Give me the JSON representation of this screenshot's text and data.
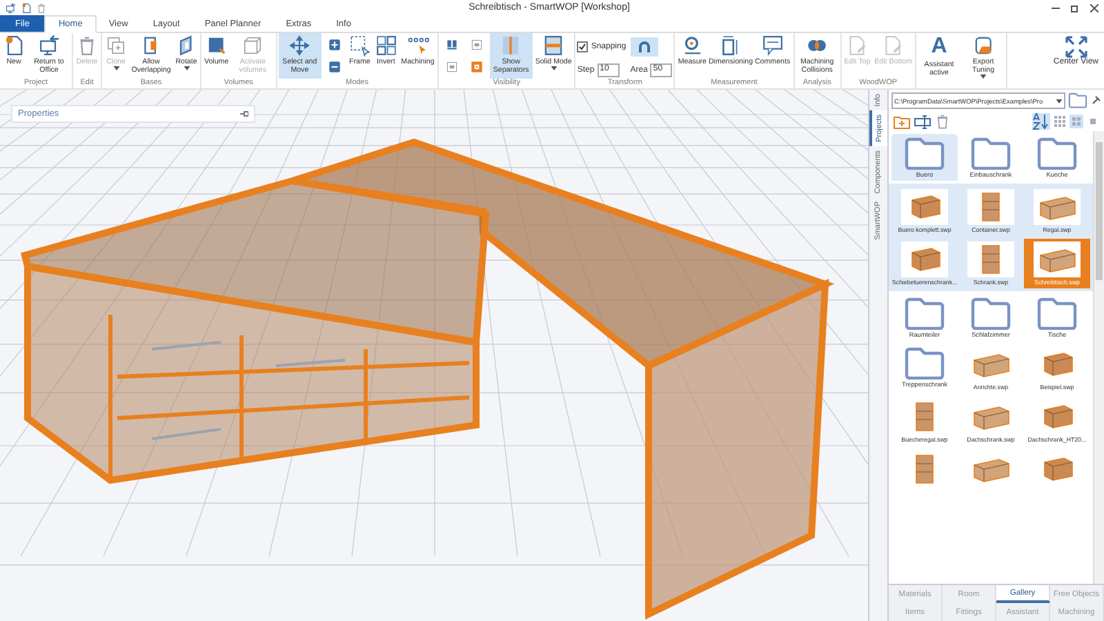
{
  "window": {
    "title": "Schreibtisch - SmartWOP [Workshop]"
  },
  "menu_tabs": [
    {
      "label": "File",
      "kind": "file",
      "selected": false
    },
    {
      "label": "Home",
      "kind": "tab",
      "selected": true
    },
    {
      "label": "View",
      "kind": "tab",
      "selected": false
    },
    {
      "label": "Layout",
      "kind": "tab",
      "selected": false
    },
    {
      "label": "Panel Planner",
      "kind": "tab",
      "selected": false
    },
    {
      "label": "Extras",
      "kind": "tab",
      "selected": false
    },
    {
      "label": "Info",
      "kind": "tab",
      "selected": false
    }
  ],
  "ribbon_groups": [
    {
      "kind": "buttons",
      "label": "Project",
      "buttons": [
        {
          "kind": "new",
          "label": "New",
          "disabled": false,
          "selected": false,
          "dropdown": false
        },
        {
          "kind": "return",
          "label": "Return to Office",
          "disabled": false,
          "selected": false,
          "dropdown": false
        }
      ]
    },
    {
      "kind": "buttons",
      "label": "Edit",
      "buttons": [
        {
          "kind": "delete",
          "label": "Delete",
          "disabled": true,
          "selected": false,
          "dropdown": false
        }
      ]
    },
    {
      "kind": "buttons",
      "label": "Bases",
      "buttons": [
        {
          "kind": "clone",
          "label": "Clone",
          "disabled": true,
          "selected": false,
          "dropdown": true
        },
        {
          "kind": "overlap",
          "label": "Allow Overlapping",
          "disabled": false,
          "selected": false,
          "dropdown": false
        },
        {
          "kind": "rotate",
          "label": "Rotate",
          "disabled": false,
          "selected": false,
          "dropdown": true
        }
      ]
    },
    {
      "kind": "buttons",
      "label": "Volumes",
      "buttons": [
        {
          "kind": "volume",
          "label": "Volume",
          "disabled": false,
          "selected": false,
          "dropdown": false
        },
        {
          "kind": "activate",
          "label": "Activate volumes",
          "disabled": true,
          "selected": false,
          "dropdown": false
        }
      ]
    },
    {
      "kind": "buttons",
      "label": "Modes",
      "buttons": [
        {
          "kind": "select",
          "label": "Select and Move",
          "disabled": false,
          "selected": true,
          "dropdown": false
        },
        {
          "kind": "stack",
          "items": [
            {
              "kind": "plus",
              "selected": false
            },
            {
              "kind": "minus",
              "selected": false
            }
          ]
        },
        {
          "kind": "frame",
          "label": "Frame",
          "disabled": false,
          "selected": false,
          "dropdown": false
        },
        {
          "kind": "invert",
          "label": "Invert",
          "disabled": false,
          "selected": false,
          "dropdown": false
        },
        {
          "kind": "machining",
          "label": "Machining",
          "disabled": false,
          "selected": false,
          "dropdown": false
        }
      ]
    },
    {
      "kind": "buttons",
      "label": "Visibility",
      "buttons": [
        {
          "kind": "stack",
          "items": [
            {
              "kind": "layout",
              "selected": false
            },
            {
              "kind": "grey",
              "selected": false
            }
          ]
        },
        {
          "kind": "stack",
          "items": [
            {
              "kind": "grey",
              "selected": false
            },
            {
              "kind": "orange",
              "selected": false
            }
          ]
        },
        {
          "kind": "separators",
          "label": "Show Separators",
          "disabled": false,
          "selected": true,
          "dropdown": false
        },
        {
          "kind": "solid",
          "label": "Solid Mode",
          "disabled": false,
          "selected": false,
          "dropdown": true
        }
      ]
    },
    {
      "kind": "transform",
      "label": "Transform",
      "snapping": {
        "label": "Snapping",
        "checked": true
      },
      "step": {
        "label": "Step",
        "value": "10"
      },
      "magnet": {
        "selected": true
      },
      "area": {
        "label": "Area",
        "value": "50"
      }
    },
    {
      "kind": "buttons",
      "label": "Measurement",
      "buttons": [
        {
          "kind": "measure",
          "label": "Measure",
          "disabled": false,
          "selected": false,
          "dropdown": false
        },
        {
          "kind": "dimension",
          "label": "Dimensioning",
          "disabled": false,
          "selected": false,
          "dropdown": false
        },
        {
          "kind": "comments",
          "label": "Comments",
          "disabled": false,
          "selected": false,
          "dropdown": false
        }
      ]
    },
    {
      "kind": "buttons",
      "label": "Analysis",
      "buttons": [
        {
          "kind": "collisions",
          "label": "Machining Collisions",
          "disabled": false,
          "selected": false,
          "dropdown": false
        }
      ]
    },
    {
      "kind": "buttons",
      "label": "WoodWOP",
      "buttons": [
        {
          "kind": "edit",
          "label": "Edit Top",
          "disabled": true,
          "selected": false,
          "dropdown": false
        },
        {
          "kind": "edit",
          "label": "Edit Bottom",
          "disabled": true,
          "selected": false,
          "dropdown": false
        }
      ]
    },
    {
      "kind": "buttons",
      "buttons": [
        {
          "kind": "assistant",
          "icon_text": "A",
          "label": "Assistant active",
          "disabled": false,
          "selected": false,
          "dropdown": false
        },
        {
          "kind": "export",
          "label": "Export Tuning",
          "disabled": false,
          "selected": false,
          "dropdown": true
        }
      ]
    }
  ],
  "center_view": {
    "label": "Center View"
  },
  "properties_panel": {
    "title": "Properties"
  },
  "side_tabs": [
    {
      "label": "Info",
      "selected": false
    },
    {
      "label": "Projects",
      "selected": true
    },
    {
      "label": "Components",
      "selected": false
    },
    {
      "label": "SmartWOP",
      "selected": false
    }
  ],
  "path_field": {
    "value": "C:\\ProgramData\\SmartWOP\\Projects\\Examples\\Pro"
  },
  "gallery": {
    "folders": [
      {
        "label": "Buero",
        "selected": true
      },
      {
        "label": "Einbauschrank",
        "selected": false
      },
      {
        "label": "Kueche",
        "selected": false
      }
    ],
    "open_folder_items": [
      {
        "label": "Buero komplett.swp",
        "selected": false
      },
      {
        "label": "Container.swp",
        "selected": false
      },
      {
        "label": "Regal.swp",
        "selected": false
      },
      {
        "label": "Schiebetuerenschrank...",
        "selected": false
      },
      {
        "label": "Schrank.swp",
        "selected": false
      },
      {
        "label": "Schreibtisch.swp",
        "selected": true
      }
    ],
    "items": [
      {
        "kind": "folder",
        "label": "Raumteiler"
      },
      {
        "kind": "folder",
        "label": "Schlafzimmer"
      },
      {
        "kind": "folder",
        "label": "Tische"
      },
      {
        "kind": "folder",
        "label": "Treppenschrank"
      },
      {
        "kind": "file",
        "label": "Anrichte.swp"
      },
      {
        "kind": "file",
        "label": "Beispiel.swp"
      },
      {
        "kind": "file",
        "label": "Buecheregal.swp"
      },
      {
        "kind": "file",
        "label": "Dachschrank.swp"
      },
      {
        "kind": "file",
        "label": "Dachschrank_HT20..."
      },
      {
        "kind": "file"
      },
      {
        "kind": "file"
      },
      {
        "kind": "file"
      }
    ]
  },
  "bottom_tabs": [
    [
      {
        "label": "Materials",
        "selected": false
      },
      {
        "label": "Room",
        "selected": false
      },
      {
        "label": "Gallery",
        "selected": true
      },
      {
        "label": "Free Objects",
        "selected": false
      }
    ],
    [
      {
        "label": "Items",
        "selected": false
      },
      {
        "label": "Fittings",
        "selected": false
      },
      {
        "label": "Assistant",
        "selected": false
      },
      {
        "label": "Machining",
        "selected": false
      }
    ]
  ]
}
